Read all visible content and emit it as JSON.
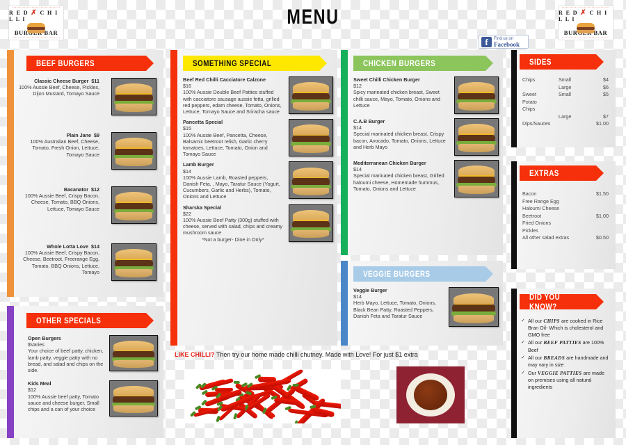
{
  "header": {
    "title": "MENU",
    "logo": {
      "top_text": "RED CHILLI",
      "bottom_text": "BURGER BAR"
    },
    "facebook": {
      "line1": "Find us on",
      "line2": "Facebook"
    }
  },
  "beef": {
    "heading": "BEEF BURGERS",
    "items": [
      {
        "name": "Classic Cheese Burger",
        "price": "$11",
        "desc": "100% Aussie Beef, Cheese, Pickles, Dijon Mustard, Tomayo Sauce"
      },
      {
        "name": "Plain Jane",
        "price": "$9",
        "desc": "100% Australian Beef, Cheese, Tomato, Fresh Onion, Lettuce, Tomayo Sauce"
      },
      {
        "name": "Bacanator",
        "price": "$12",
        "desc": "100% Aussie Beef, Crispy Bacon, Cheese, Tomato, BBQ Onions, Lettuce, Tomayo Sauce"
      },
      {
        "name": "Whole Lotta Love",
        "price": "$14",
        "desc": "100% Aussie Beef, Crispy Bacon, Cheese, Beetroot, Freerange Egg, Tomato, BBQ Onions, Lettuce, Tomayo"
      }
    ]
  },
  "other_specials": {
    "heading": "OTHER SPECIALS",
    "items": [
      {
        "name": "Open Burgers",
        "price": "$Varies",
        "desc": "Your choice of beef patty, chicken, lamb patty, veggie patty with no bread, and salad and chips on the side."
      },
      {
        "name": "Kids Meal",
        "price": "$12",
        "desc": "100% Aussie beef patty, Tomato sauce and cheese burger, Small chips and a can of your choice"
      }
    ]
  },
  "something_special": {
    "heading": "SOMETHING SPECIAL",
    "items": [
      {
        "name": "Beef Red Chilli Cacciatore Calzone",
        "price": "$16",
        "desc": "100% Aussie Double Beef Patties stuffed with cacciatore sausage aussie fetta, grilled red peppers, edam cheese, Tomato, Onions, Lettuce, Tomayo Sauce and Sriracha sauce"
      },
      {
        "name": "Pancetta Special",
        "price": "$15",
        "desc": "100% Aussie Beef, Pancetta, Cheese, Balsamic beetroot relish, Garlic cherry tomatoes, Lettuce, Tomato, Onion and Tomayo Sauce"
      },
      {
        "name": "Lamb Burger",
        "price": "$14",
        "desc": "100% Aussie Lamb, Roasted peppers, Danish Feta, , Mayo, Taratur Sauce (Yogurt, Cucumbers, Garlic and Herbs), Tomato, Onions and Lettuce"
      },
      {
        "name": "Sharska Special",
        "price": "$22",
        "desc": "100% Aussie Beef Patty (300g) stuffed with cheese, served with salad, chips and creamy mushroom sauce",
        "note": "*Not a burger- Dine in Only*"
      }
    ]
  },
  "chicken": {
    "heading": "CHICKEN BURGERS",
    "items": [
      {
        "name": "Sweet Chilli Chicken Burger",
        "price": "$12",
        "desc": "Spicy marinated chicken breast, Sweet chilli sauce, Mayo, Tomato, Onions and Lettuce"
      },
      {
        "name": "C.A.B Burger",
        "price": "$14",
        "desc": "Special marinated chicken breast, Crispy bacon, Avocado, Tomato, Onions, Lettuce and Herb Mayo"
      },
      {
        "name": "Mediterranean Chicken Burger",
        "price": "$14",
        "desc": "Special marinated chicken breast, Grilled haloumi cheese, Homemade hummus, Tomato, Onions and Lettuce"
      }
    ]
  },
  "veggie": {
    "heading": "VEGGIE BURGERS",
    "items": [
      {
        "name": "Veggie Burger",
        "price": "$14",
        "desc": "Herb Mayo, Lettuce, Tomato, Onions, Black Bean Patty, Roasted Peppers, Danish Feta and Taratur Sauce"
      }
    ]
  },
  "sides": {
    "heading": "SIDES",
    "rows": [
      {
        "item": "Chips",
        "size": "Small",
        "price": "$4"
      },
      {
        "item": "",
        "size": "Large",
        "price": "$6"
      },
      {
        "item": "Sweet Potato Chips",
        "size": "Small",
        "price": "$5"
      },
      {
        "item": "",
        "size": "Large",
        "price": "$7"
      },
      {
        "item": "Dips/Sauces",
        "size": "",
        "price": "$1.00"
      }
    ]
  },
  "extras": {
    "heading": "EXTRAS",
    "groups": [
      {
        "items": "Bacon\nFree Range Egg\nHaloumi Cheese",
        "price": "$1.50"
      },
      {
        "items": "Beetroot\nFried Onions\nPickles",
        "price": "$1.00"
      },
      {
        "items": "All other salad extras",
        "price": "$0.50"
      }
    ]
  },
  "did_you_know": {
    "heading": "DID YOU KNOW?",
    "facts": [
      {
        "pre": "All our ",
        "em": "CHIPS",
        "post": " are cooked in Rice Bran Oil- Which is cholesterol and GMO free"
      },
      {
        "pre": "All our ",
        "em": "BEEF PATTIES",
        "post": " are 100% Beef"
      },
      {
        "pre": "All our ",
        "em": "BREADS",
        "post": " are handmade and may vary in size"
      },
      {
        "pre": "Our ",
        "em": "VEGGIE PATTIES",
        "post": " are made on premises using all natural ingredients"
      }
    ]
  },
  "chilli_banner": {
    "highlight": "LIKE CHILLI?",
    "text": " Then try our home made chilli chutney. Made with Love! For just $1 extra"
  },
  "colors": {
    "red": "#f5300a",
    "yellow": "#ffe800",
    "green": "#8cc55c",
    "dark_green": "#16b05a",
    "blue": "#a8cbe8",
    "dark_blue": "#4a87c9",
    "orange": "#f0923a",
    "purple": "#8641c4",
    "facebook_blue": "#3b5998"
  }
}
